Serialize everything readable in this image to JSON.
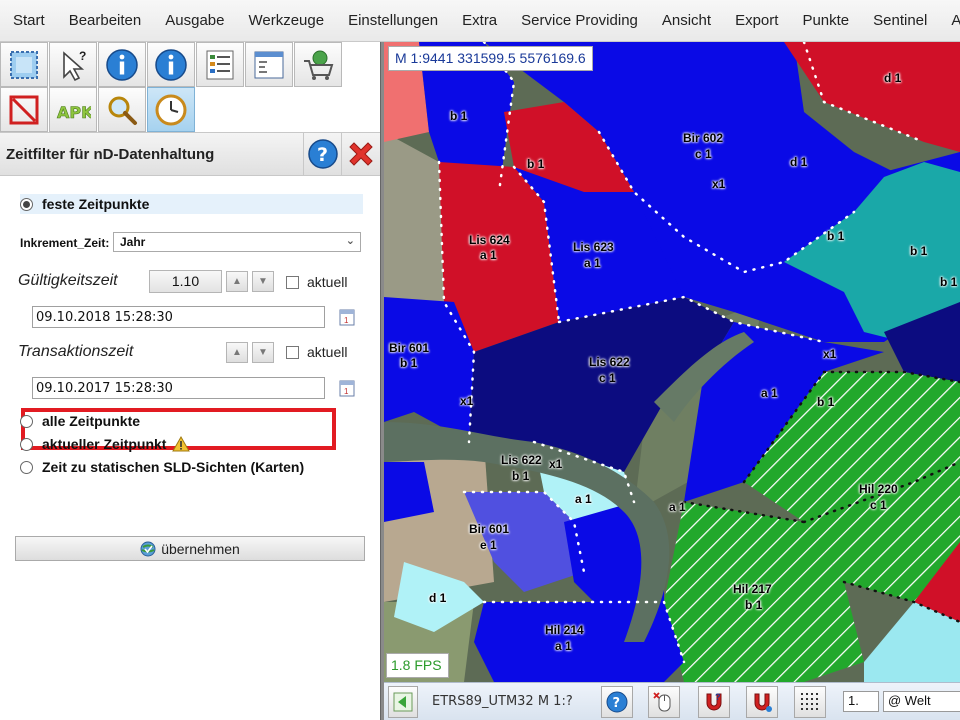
{
  "menubar": {
    "items": [
      "Start",
      "Bearbeiten",
      "Ausgabe",
      "Werkzeuge",
      "Einstellungen",
      "Extra",
      "Service Providing",
      "Ansicht",
      "Export",
      "Punkte",
      "Sentinel",
      "A"
    ]
  },
  "toolbar": {
    "row1": [
      "layer-icon",
      "pointer-help-icon",
      "info-icon",
      "info-icon",
      "form-list-icon",
      "table-window-icon",
      "cart-icon"
    ],
    "row2": [
      "no-entry-icon",
      "apk-icon",
      "magnifier-icon",
      "clock-icon"
    ]
  },
  "panel": {
    "title": "Zeitfilter für nD-Datenhaltung",
    "radio_fixed": "feste Zeitpunkte",
    "increment_label": "Inkrement_Zeit:",
    "increment_value": "Jahr",
    "validity_label": "Gültigkeitszeit",
    "validity_step": "1.10",
    "current_label": "aktuell",
    "validity_date": "09.10.2018 15:28:30",
    "transaction_label": "Transaktionszeit",
    "transaction_date": "09.10.2017 15:28:30",
    "radio_all": "alle Zeitpunkte",
    "radio_current": "aktueller Zeitpunkt",
    "radio_sld": "Zeit zu statischen SLD-Sichten (Karten)",
    "apply_label": "übernehmen"
  },
  "map": {
    "scale_text": "M 1:9441   331599.5 5576169.6",
    "fps": "1.8 FPS",
    "labels": [
      {
        "id": "d1",
        "text": "d 1"
      },
      {
        "id": "b1a",
        "text": "b 1"
      },
      {
        "id": "bir602",
        "text": "Bir 602"
      },
      {
        "id": "c1a",
        "text": "c 1"
      },
      {
        "id": "b1b",
        "text": "b 1"
      },
      {
        "id": "d1b",
        "text": "d 1"
      },
      {
        "id": "x1a",
        "text": "x1"
      },
      {
        "id": "lis624",
        "text": "Lis 624"
      },
      {
        "id": "a1a",
        "text": "a 1"
      },
      {
        "id": "lis623",
        "text": "Lis 623"
      },
      {
        "id": "a1b",
        "text": "a 1"
      },
      {
        "id": "b1c",
        "text": "b 1"
      },
      {
        "id": "b1d",
        "text": "b 1"
      },
      {
        "id": "b1e",
        "text": "b 1"
      },
      {
        "id": "bir601a",
        "text": "Bir 601"
      },
      {
        "id": "b1f",
        "text": "b 1"
      },
      {
        "id": "lis622a",
        "text": "Lis 622"
      },
      {
        "id": "c1b",
        "text": "c 1"
      },
      {
        "id": "x1b",
        "text": "x1"
      },
      {
        "id": "x1c",
        "text": "x1"
      },
      {
        "id": "a1c",
        "text": "a 1"
      },
      {
        "id": "b1g",
        "text": "b 1"
      },
      {
        "id": "lis622b",
        "text": "Lis 622"
      },
      {
        "id": "b1h",
        "text": "b 1"
      },
      {
        "id": "x1d",
        "text": "x1"
      },
      {
        "id": "a1d",
        "text": "a 1"
      },
      {
        "id": "bir601b",
        "text": "Bir 601"
      },
      {
        "id": "e1",
        "text": "e 1"
      },
      {
        "id": "a1e",
        "text": "a 1"
      },
      {
        "id": "hil220",
        "text": "Hil 220"
      },
      {
        "id": "c1c",
        "text": "c 1"
      },
      {
        "id": "d1c",
        "text": "d 1"
      },
      {
        "id": "hil217",
        "text": "Hil 217"
      },
      {
        "id": "b1i",
        "text": "b 1"
      },
      {
        "id": "hil214",
        "text": "Hil 214"
      },
      {
        "id": "a1f",
        "text": "a 1"
      }
    ]
  },
  "statusbar": {
    "crs_text": "ETRS89_UTM32  M 1:?",
    "scale_input": "1.",
    "crs_select": "@ Welt"
  },
  "colors": {
    "accent_red": "#e21b22",
    "parcel_blue": "#0a0ae6",
    "parcel_navy": "#0c0c80",
    "parcel_red": "#d01028",
    "parcel_teal": "#1aa8a8",
    "parcel_green": "#20a830"
  }
}
